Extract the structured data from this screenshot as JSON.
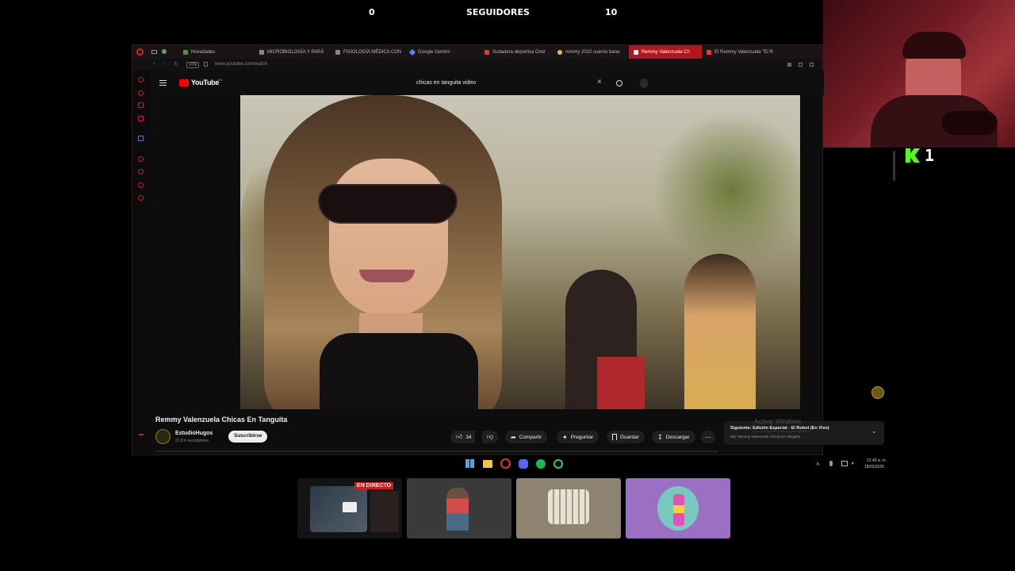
{
  "overlay": {
    "left_count": "0",
    "followers_label": "SEGUIDORES",
    "right_count": "10",
    "kick_count": "1"
  },
  "browser": {
    "tabs": [
      {
        "label": "Novedades",
        "color": "#3f9b3f"
      },
      {
        "label": "MICROBIOLOGÍA Y PARÁ",
        "color": "#888888"
      },
      {
        "label": "FISIOLOGÍA MÉDICA CON",
        "color": "#888888"
      },
      {
        "label": "Google Gemini",
        "color": "#4a8af4"
      },
      {
        "label": "Sudadera deportiva Over",
        "color": "#d04040"
      },
      {
        "label": "remmy 2010 cuerno bana",
        "color": "#e0c040"
      },
      {
        "label": "Remmy Valenzuela Ch",
        "color": "#ff3030",
        "active": true
      },
      {
        "label": "El Remmy Valenzuela \"El R",
        "color": "#ff3030"
      }
    ],
    "url": "www.youtube.com/watch",
    "vpn": "VPN"
  },
  "youtube": {
    "logo_text": "YouTube",
    "logo_suffix": "MX",
    "search_value": "chicas en tanguita video",
    "video_title": "Remmy Valenzuela Chicas En Tanguita",
    "channel_name": "EstudioHugos",
    "subscribers": "21.8 k suscriptores",
    "subscribe_label": "Suscribirse",
    "like_count": "34",
    "share_label": "Compartir",
    "ask_label": "Preguntar",
    "save_label": "Guardar",
    "download_label": "Descargar",
    "next_title": "Siguiente: Edición Especial - El Robot (En Vivo)",
    "next_sub": "Mix: Remmy Valenzuela Chicas En Tanguita",
    "activate_windows": "Activar Windows",
    "activate_windows_sub": "Ve a Configuración para activar Windows."
  },
  "taskbar": {
    "time": "12:40 a. m.",
    "date": "18/02/2026"
  },
  "thumbs": {
    "live_badge": "EN DIRECTO"
  },
  "colors": {
    "accent_red": "#b3151d",
    "kick_green": "#53fc18",
    "thumb_purple": "#9b6fc4"
  }
}
